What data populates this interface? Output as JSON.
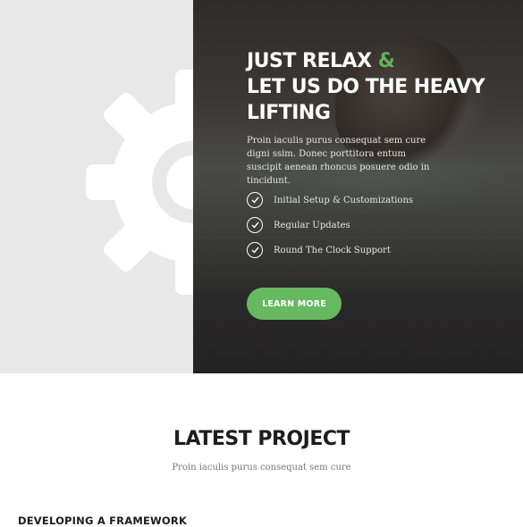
{
  "hero": {
    "title_line1": "JUST RELAX",
    "title_amp": "&",
    "title_line2": "LET US DO THE HEAVY",
    "title_line3": "LIFTING",
    "description": "Proin iaculis purus consequat sem cure digni ssim. Donec porttitora entum suscipit aenean rhoncus posuere odio in tincidunt.",
    "features": [
      {
        "label": "Initial Setup & Customizations",
        "icon": "check-circle-icon"
      },
      {
        "label": "Regular Updates",
        "icon": "check-circle-icon"
      },
      {
        "label": "Round The Clock Support",
        "icon": "check-circle-icon"
      }
    ],
    "cta_label": "LEARN MORE",
    "decor_icon": "gear-icon",
    "colors": {
      "accent": "#66b960",
      "left_panel": "#e8e8e8",
      "dark_overlay": "#2e2c2b"
    }
  },
  "latest": {
    "title": "LATEST PROJECT",
    "subtitle": "Proin iaculis purus consequat sem cure"
  },
  "projects": [
    {
      "title": "DEVELOPING A FRAMEWORK"
    }
  ]
}
